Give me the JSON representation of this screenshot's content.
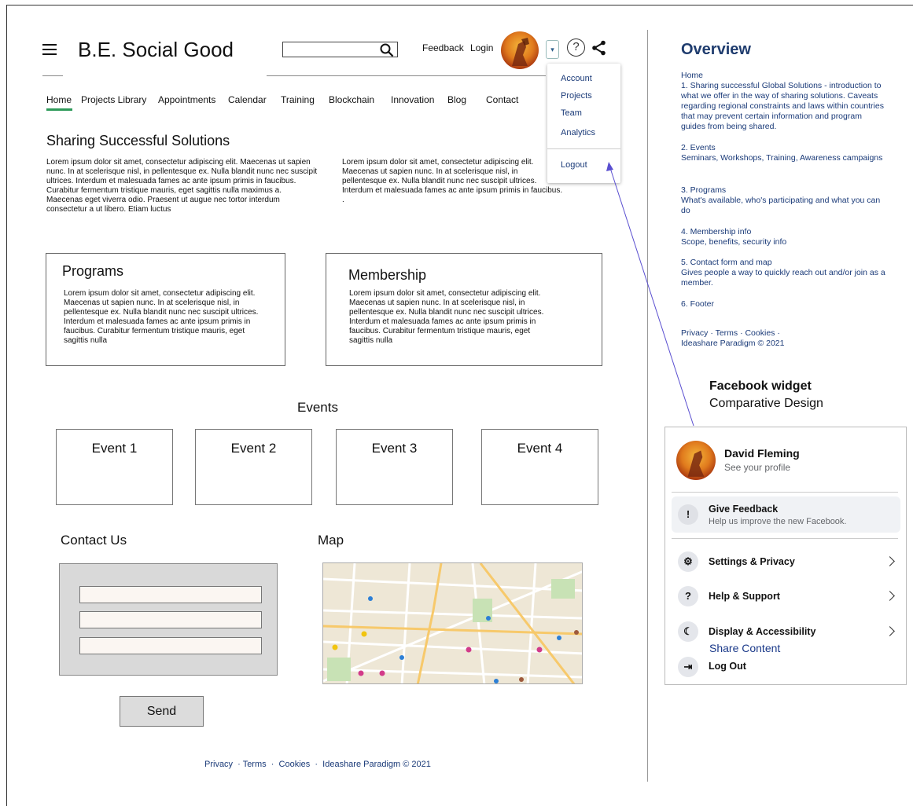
{
  "header": {
    "site_title": "B.E. Social Good",
    "search_placeholder": "",
    "feedback_link": "Feedback",
    "login_link": "Login",
    "dropdown_arrow": "▾",
    "help_symbol": "?"
  },
  "nav": {
    "items": [
      "Home",
      "Projects Library",
      "Appointments",
      "Calendar",
      "Training",
      "Blockchain",
      "Innovation",
      "Blog",
      "Contact"
    ]
  },
  "account_menu": {
    "items": [
      "Account",
      "Projects",
      "Team",
      "Analytics"
    ],
    "logout": "Logout"
  },
  "sharing": {
    "title": "Sharing Successful Solutions",
    "col1": "Lorem ipsum dolor sit amet, consectetur adipiscing elit. Maecenas ut sapien nunc. In at scelerisque nisl, in pellentesque ex. Nulla blandit nunc nec suscipit ultrices. Interdum et malesuada fames ac ante ipsum primis in faucibus. Curabitur fermentum tristique mauris, eget sagittis nulla maximus a. Maecenas eget viverra odio. Praesent ut augue nec tortor interdum consectetur a ut libero. Etiam luctus",
    "col2": "Lorem ipsum dolor sit amet, consectetur adipiscing elit. Maecenas ut sapien nunc. In at scelerisque nisl, in pellentesque ex. Nulla blandit nunc nec suscipit ultrices. Interdum et malesuada fames ac ante ipsum primis in faucibus. ."
  },
  "programs": {
    "title": "Programs",
    "text": "Lorem ipsum dolor sit amet, consectetur adipiscing elit. Maecenas ut sapien nunc. In at scelerisque nisl, in pellentesque ex. Nulla blandit nunc nec suscipit ultrices. Interdum et malesuada fames ac ante ipsum primis in faucibus. Curabitur fermentum tristique mauris, eget sagittis nulla"
  },
  "membership": {
    "title": "Membership",
    "text": "Lorem ipsum dolor sit amet, consectetur adipiscing elit. Maecenas ut sapien nunc. In at scelerisque nisl, in pellentesque ex. Nulla blandit nunc nec suscipit ultrices. Interdum et malesuada fames ac ante ipsum primis in faucibus. Curabitur fermentum tristique mauris, eget sagittis nulla"
  },
  "events": {
    "title": "Events",
    "items": [
      "Event 1",
      "Event 2",
      "Event 3",
      "Event 4"
    ]
  },
  "contact": {
    "title": "Contact Us",
    "send_label": "Send"
  },
  "map": {
    "title": "Map"
  },
  "footer": {
    "text": "Privacy  · Terms  ·  Cookies  ·  Ideashare Paradigm © 2021"
  },
  "overview": {
    "title": "Overview",
    "home": "Home",
    "s1": "1. Sharing successful Global Solutions - introduction to what we offer in the way of sharing solutions. Caveats regarding regional constraints and laws within countries that may prevent certain information and program guides from being shared.",
    "s2": "2. Events\nSeminars, Workshops, Training, Awareness campaigns",
    "s3": "3. Programs\nWhat's available, who's participating and what you can do",
    "s4": "4. Membership info\nScope, benefits, security info",
    "s5": "5. Contact form and map\nGives people a way to quickly reach out and/or join as a member.",
    "s6": "6.  Footer",
    "footer": "Privacy  · Terms  ·  Cookies  ·\nIdeashare Paradigm © 2021"
  },
  "facebook_widget": {
    "title": "Facebook widget",
    "subtitle": "Comparative Design",
    "profile_name": "David Fleming",
    "profile_sub": "See your profile",
    "feedback_title": "Give Feedback",
    "feedback_sub": "Help us improve the new Facebook.",
    "settings": "Settings & Privacy",
    "help": "Help & Support",
    "display": "Display & Accessibility",
    "share": "Share Content",
    "logout": "Log Out"
  },
  "colors": {
    "nav_underline": "#2e9a5a",
    "link_blue": "#1a3a78",
    "overview_title": "#1f3c6e",
    "fb_share_blue": "#1b3a8a"
  }
}
